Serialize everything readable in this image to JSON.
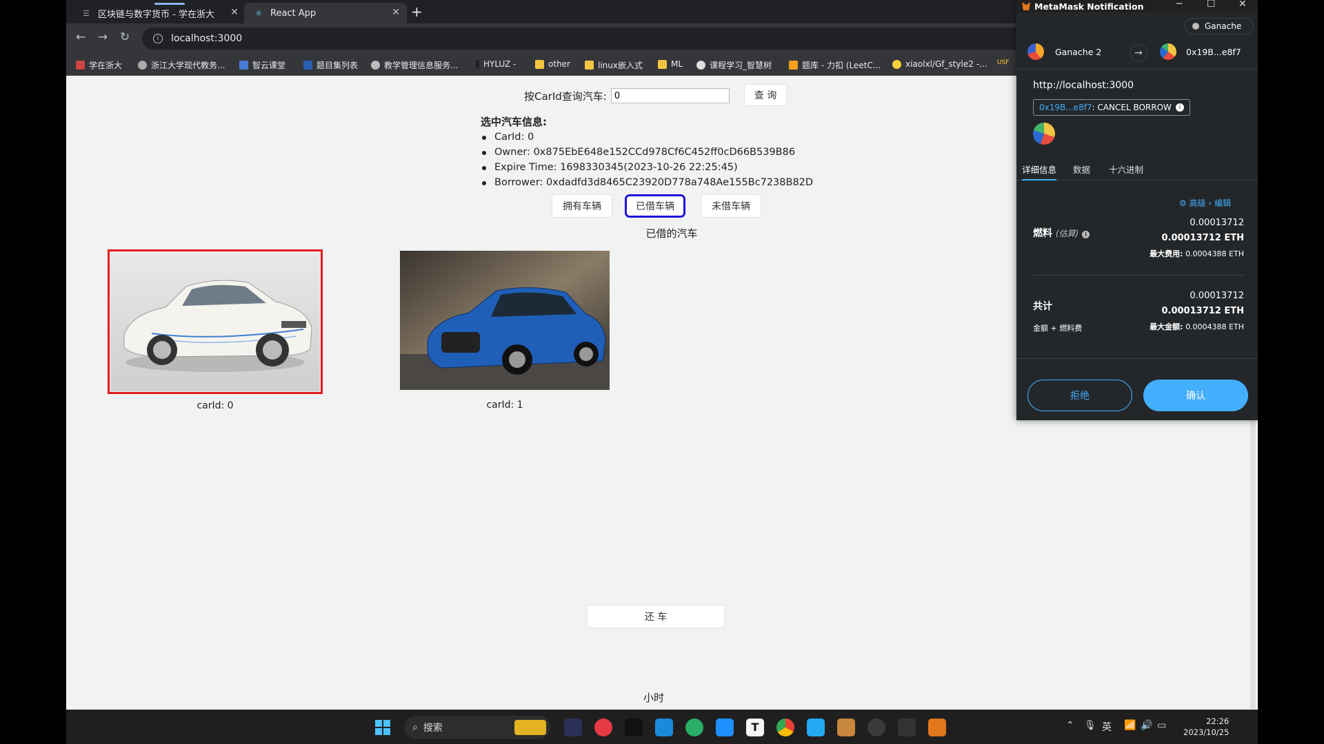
{
  "browser": {
    "tabs": [
      {
        "title": "区块链与数字货币 - 学在浙大"
      },
      {
        "title": "React App"
      }
    ],
    "url": "localhost:3000",
    "bookmarks": [
      "学在浙大",
      "浙江大学现代教务...",
      "智云课堂",
      "题目集列表",
      "教学管理信息服务...",
      "HYLUZ -",
      "other",
      "linux嵌入式",
      "ML",
      "课程学习_智慧树",
      "题库 - 力扣 (LeetC...",
      "xiaolxl/Gf_style2 -...",
      "USF"
    ]
  },
  "page": {
    "query_label": "按CarId查询汽车:",
    "query_value": "0",
    "query_button": "查 询",
    "info_title": "选中汽车信息:",
    "info": {
      "car_id": "CarId: 0",
      "owner": "Owner: 0x875EbE648e152CCd978Cf6C452ff0cD66B539B86",
      "expire": "Expire Time: 1698330345(2023-10-26 22:25:45)",
      "borrower": "Borrower: 0xdadfd3d8465C23920D778a748Ae155Bc7238B82D"
    },
    "filters": [
      "拥有车辆",
      "已借车辆",
      "未借车辆"
    ],
    "selected_filter": "已借车辆",
    "list_title": "已借的汽车",
    "cars": [
      {
        "caption": "carId: 0",
        "selected": true
      },
      {
        "caption": "carId: 1",
        "selected": false
      }
    ],
    "return_button": "还 车",
    "hours_label": "小时"
  },
  "taskbar": {
    "search": "搜索",
    "lang": "英",
    "time": "22:26",
    "date": "2023/10/25"
  },
  "metamask": {
    "window_title": "MetaMask Notification",
    "network": "Ganache",
    "from_account": "Ganache 2",
    "to_account": "0x19B...e8f7",
    "origin": "http://localhost:3000",
    "method_addr": "0x19B...e8f7",
    "method_name": ": CANCEL BORROW",
    "tabs": [
      "详细信息",
      "数据",
      "十六进制"
    ],
    "advanced": "高级",
    "edit": "编辑",
    "gas_label": "燃料",
    "gas_est": "(估算)",
    "gas_value": "0.00013712",
    "gas_eth": "0.00013712 ETH",
    "max_fee_label": "最大费用:",
    "max_fee": "0.0004388 ETH",
    "total_label": "共计",
    "total_value": "0.00013712",
    "total_eth": "0.00013712 ETH",
    "total_sub": "金额 + 燃料费",
    "max_amount_label": "最大金额:",
    "max_amount": "0.0004388 ETH",
    "reject": "拒绝",
    "confirm": "确认",
    "colors": {
      "accent": "#43aefc",
      "bg": "#24272a"
    }
  }
}
